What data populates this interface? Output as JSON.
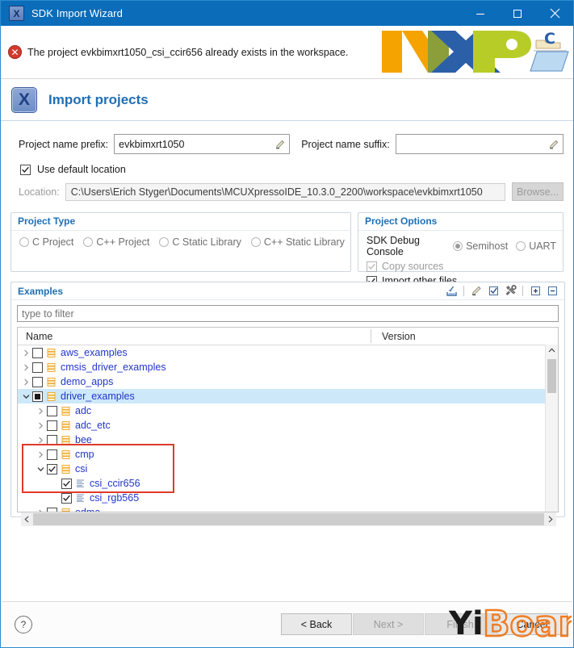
{
  "window": {
    "title": "SDK Import Wizard",
    "icon": "x-app-icon",
    "minimize_label": "–",
    "maximize_label": "☐",
    "close_label": "✕"
  },
  "banner": {
    "error_icon": "error-circle-icon",
    "error_text": "The project evkbimxrt1050_csi_ccir656 already exists in the workspace.",
    "logo_text": "NXP",
    "logo_folder_letter": "C"
  },
  "page_header": {
    "icon": "x-wizard-icon",
    "title": "Import projects"
  },
  "form": {
    "prefix_label": "Project name prefix:",
    "prefix_value": "evkbimxrt1050",
    "prefix_placeholder": "",
    "suffix_label": "Project name suffix:",
    "suffix_value": "",
    "suffix_placeholder": "",
    "edit_icon": "variables-edit-icon",
    "use_default_location_label": "Use default location",
    "use_default_location_checked": true,
    "location_label": "Location:",
    "location_value": "C:\\Users\\Erich Styger\\Documents\\MCUXpressoIDE_10.3.0_2200\\workspace\\evkbimxrt1050",
    "browse_label": "Browse..."
  },
  "project_type": {
    "title": "Project Type",
    "options": [
      {
        "label": "C Project",
        "selected": false
      },
      {
        "label": "C++ Project",
        "selected": false
      },
      {
        "label": "C Static Library",
        "selected": false
      },
      {
        "label": "C++ Static Library",
        "selected": false
      }
    ]
  },
  "project_options": {
    "title": "Project Options",
    "sdk_debug_console_label": "SDK Debug Console",
    "console_options": [
      {
        "label": "Semihost",
        "selected": true
      },
      {
        "label": "UART",
        "selected": false
      }
    ],
    "copy_sources_label": "Copy sources",
    "copy_sources_checked": true,
    "copy_sources_enabled": false,
    "import_other_files_label": "Import other files",
    "import_other_files_checked": true,
    "import_other_files_enabled": true
  },
  "examples": {
    "title": "Examples",
    "toolbar": [
      {
        "name": "import-icon"
      },
      {
        "name": "separator"
      },
      {
        "name": "eraser-icon"
      },
      {
        "name": "select-checkbox-icon"
      },
      {
        "name": "build-settings-icon"
      },
      {
        "name": "separator"
      },
      {
        "name": "expand-all-icon"
      },
      {
        "name": "collapse-all-icon"
      }
    ],
    "filter_placeholder": "type to filter",
    "filter_value": "",
    "columns": [
      "Name",
      "Version"
    ],
    "rows": [
      {
        "label": "aws_examples",
        "depth": 0,
        "expander": "collapsed",
        "check": "unchecked",
        "icon": "example-group-icon",
        "selected": false,
        "type": "group"
      },
      {
        "label": "cmsis_driver_examples",
        "depth": 0,
        "expander": "collapsed",
        "check": "unchecked",
        "icon": "example-group-icon",
        "selected": false,
        "type": "group"
      },
      {
        "label": "demo_apps",
        "depth": 0,
        "expander": "collapsed",
        "check": "unchecked",
        "icon": "example-group-icon",
        "selected": false,
        "type": "group"
      },
      {
        "label": "driver_examples",
        "depth": 0,
        "expander": "expanded",
        "check": "partial",
        "icon": "example-group-icon",
        "selected": true,
        "type": "group"
      },
      {
        "label": "adc",
        "depth": 1,
        "expander": "collapsed",
        "check": "unchecked",
        "icon": "example-group-icon",
        "selected": false,
        "type": "group"
      },
      {
        "label": "adc_etc",
        "depth": 1,
        "expander": "collapsed",
        "check": "unchecked",
        "icon": "example-group-icon",
        "selected": false,
        "type": "group"
      },
      {
        "label": "bee",
        "depth": 1,
        "expander": "collapsed",
        "check": "unchecked",
        "icon": "example-group-icon",
        "selected": false,
        "type": "group"
      },
      {
        "label": "cmp",
        "depth": 1,
        "expander": "collapsed",
        "check": "unchecked",
        "icon": "example-group-icon",
        "selected": false,
        "type": "group"
      },
      {
        "label": "csi",
        "depth": 1,
        "expander": "expanded",
        "check": "checked",
        "icon": "example-group-icon",
        "selected": false,
        "type": "group"
      },
      {
        "label": "csi_ccir656",
        "depth": 2,
        "expander": "none",
        "check": "checked",
        "icon": "example-leaf-icon",
        "selected": false,
        "type": "leaf"
      },
      {
        "label": "csi_rgb565",
        "depth": 2,
        "expander": "none",
        "check": "checked",
        "icon": "example-leaf-icon",
        "selected": false,
        "type": "leaf"
      },
      {
        "label": "edma",
        "depth": 1,
        "expander": "collapsed",
        "check": "unchecked",
        "icon": "example-group-icon",
        "selected": false,
        "type": "group"
      }
    ],
    "highlight_annotation": "red-rectangle-around-csi-selection"
  },
  "footer": {
    "help_label": "?",
    "buttons": [
      {
        "label": "< Back",
        "enabled": true
      },
      {
        "label": "Next >",
        "enabled": false
      },
      {
        "label": "Finish",
        "enabled": false
      },
      {
        "label": "Cancel",
        "enabled": true
      }
    ]
  },
  "watermark": {
    "text_dark": "Yi",
    "text_accent": "Board"
  },
  "colors": {
    "titlebar": "#0b6cba",
    "accent_blue": "#1f6fb5",
    "tree_text": "#2236c9",
    "selection": "#cde8f9",
    "error_red": "#d13b2e",
    "annotation_red": "#e03a2a",
    "watermark_orange": "#f07c22"
  }
}
